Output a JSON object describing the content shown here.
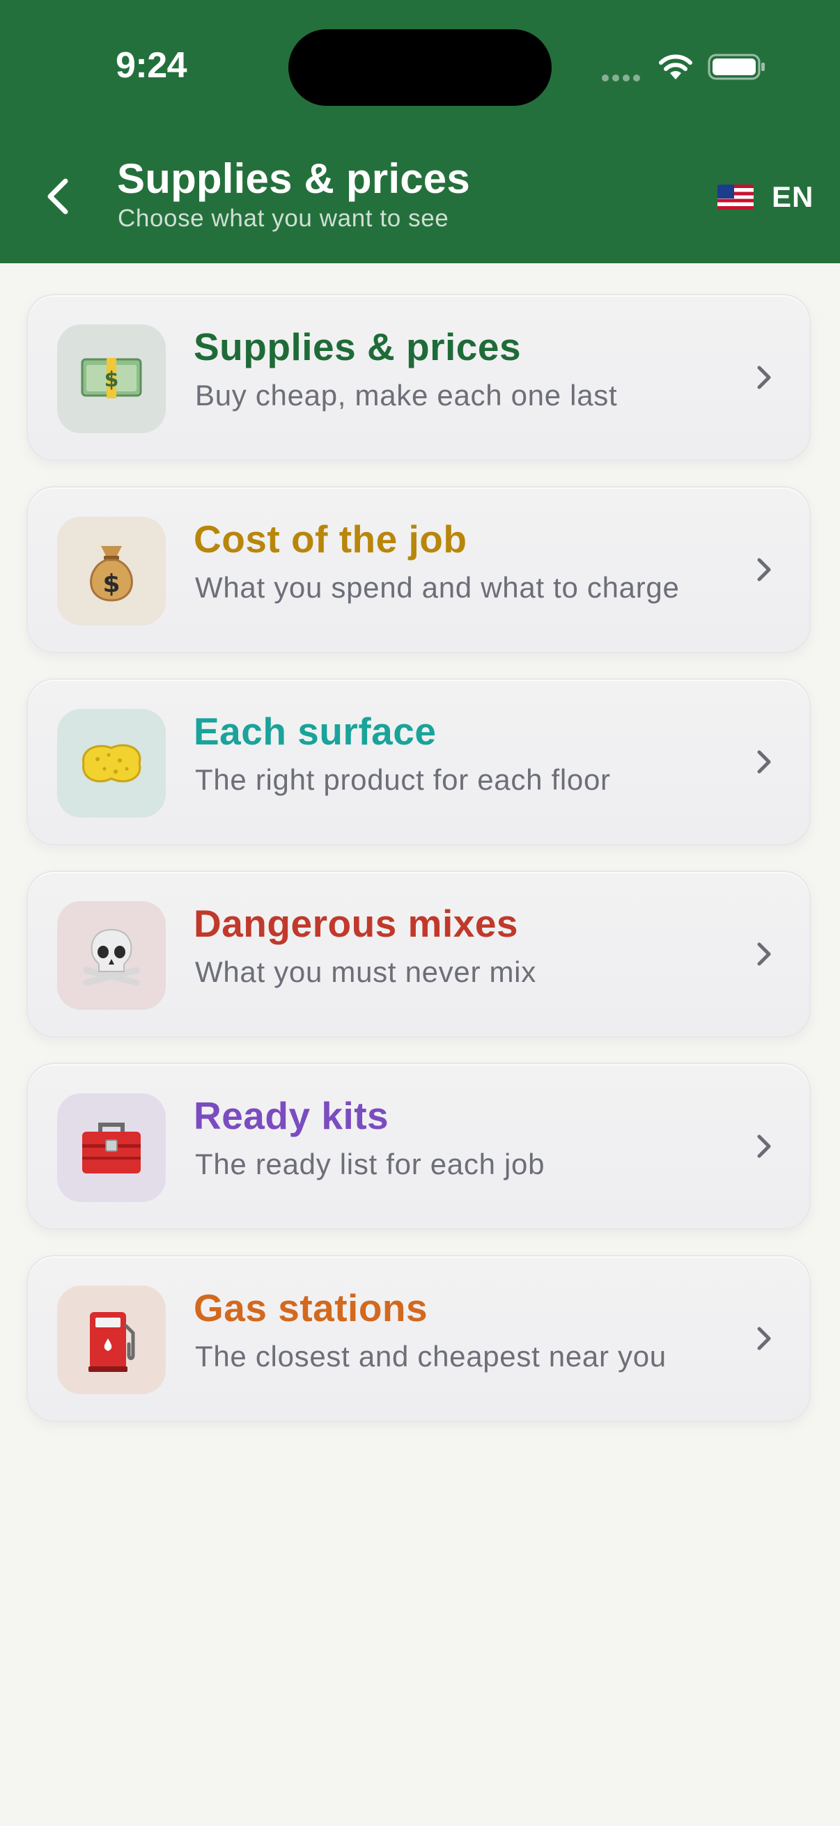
{
  "status_bar": {
    "time": "9:24"
  },
  "header": {
    "title": "Supplies & prices",
    "subtitle": "Choose what you want to see",
    "language": "EN"
  },
  "menu": [
    {
      "title": "Supplies & prices",
      "description": "Buy cheap, make each one last",
      "icon": "money-icon",
      "emoji": "💵",
      "title_color": "#1f6b38",
      "icon_bg": "#dbe1dc"
    },
    {
      "title": "Cost of the job",
      "description": "What you spend and what to charge",
      "icon": "money-bag-icon",
      "emoji": "💰",
      "title_color": "#b8860b",
      "icon_bg": "#ebe5da"
    },
    {
      "title": "Each surface",
      "description": "The right product for each floor",
      "icon": "sponge-icon",
      "emoji": "🧽",
      "title_color": "#1aa39a",
      "icon_bg": "#d7e5e3"
    },
    {
      "title": "Dangerous mixes",
      "description": "What you must never mix",
      "icon": "skull-crossbones-icon",
      "emoji": "☠️",
      "title_color": "#c0392b",
      "icon_bg": "#eadbdc"
    },
    {
      "title": "Ready kits",
      "description": "The ready list for each job",
      "icon": "toolbox-icon",
      "emoji": "🧰",
      "title_color": "#7b4cbf",
      "icon_bg": "#e3dde9"
    },
    {
      "title": "Gas stations",
      "description": "The closest and cheapest near you",
      "icon": "fuel-pump-icon",
      "emoji": "⛽",
      "title_color": "#d2691e",
      "icon_bg": "#eddfd8"
    }
  ]
}
